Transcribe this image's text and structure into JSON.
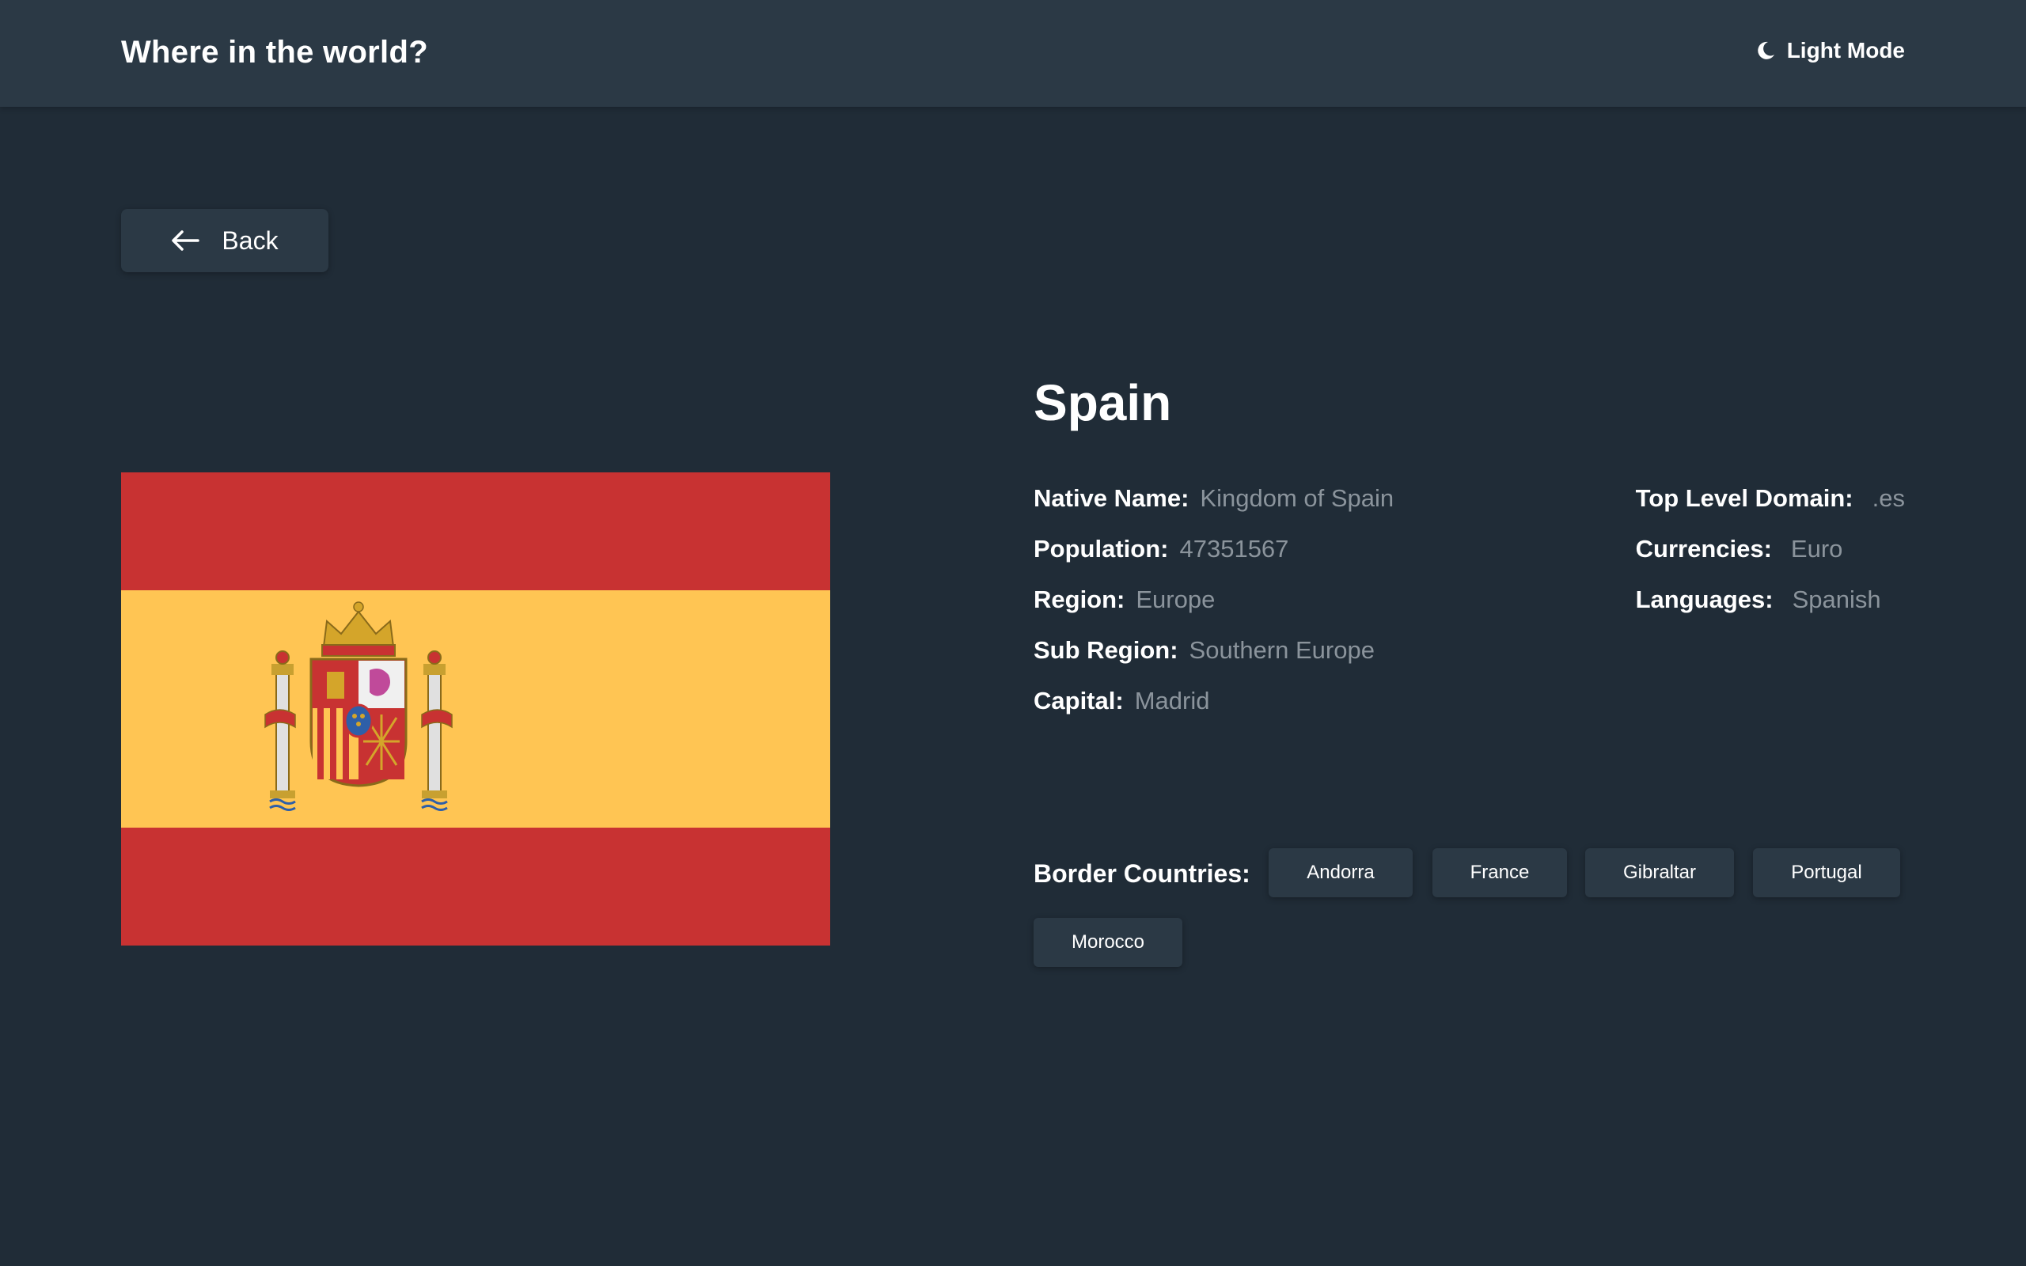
{
  "header": {
    "title": "Where in the world?",
    "mode_toggle_label": "Light Mode",
    "mode_icon": "moon-icon"
  },
  "back_button": {
    "label": "Back",
    "icon": "arrow-left-icon"
  },
  "country": {
    "name": "Spain",
    "flag_image": "flag of Spain with coat of arms",
    "details_left": [
      {
        "label": "Native Name:",
        "value": "Kingdom of Spain"
      },
      {
        "label": "Population:",
        "value": "47351567"
      },
      {
        "label": "Region:",
        "value": "Europe"
      },
      {
        "label": "Sub Region:",
        "value": "Southern Europe"
      },
      {
        "label": "Capital:",
        "value": "Madrid"
      }
    ],
    "details_right": [
      {
        "label": "Top Level Domain:",
        "value": ".es"
      },
      {
        "label": "Currencies:",
        "value": "Euro"
      },
      {
        "label": "Languages:",
        "value": "Spanish"
      }
    ],
    "border_countries_label": "Border Countries:",
    "border_countries": [
      "Andorra",
      "France",
      "Gibraltar",
      "Portugal",
      "Morocco"
    ]
  },
  "colors": {
    "background": "#202c37",
    "surface": "#2b3945",
    "text": "#ffffff",
    "muted_text": "#8b949c",
    "flag_red": "#c83232",
    "flag_yellow": "#ffc553"
  }
}
